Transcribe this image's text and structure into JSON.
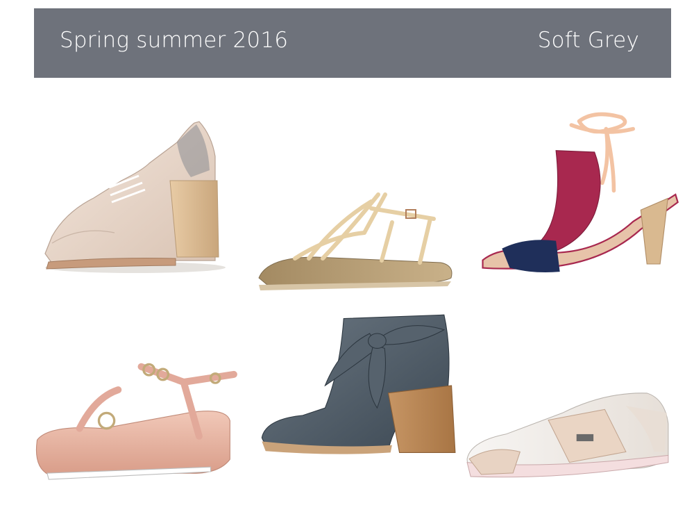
{
  "header": {
    "title": "Spring summer 2016",
    "brand": "Soft Grey"
  },
  "palette": {
    "banner": "#6e727b",
    "banner_text": "#ffffff",
    "nude": "#e9d7c9",
    "wood": "#d9b990",
    "magenta": "#a8284f",
    "navy": "#1f2f5a",
    "rose": "#e6b1a0",
    "slate": "#4d5965",
    "white_leather": "#f4f2f0"
  },
  "products": [
    {
      "name": "lace-up heeled oxford",
      "color": "nude"
    },
    {
      "name": "strappy flat sandal",
      "color": "sand"
    },
    {
      "name": "ankle-tie block heel sandal",
      "color": "magenta-navy"
    },
    {
      "name": "platform wedge sandal",
      "color": "rose"
    },
    {
      "name": "bow ankle boot",
      "color": "slate"
    },
    {
      "name": "buckle sneaker",
      "color": "white-rose"
    }
  ]
}
